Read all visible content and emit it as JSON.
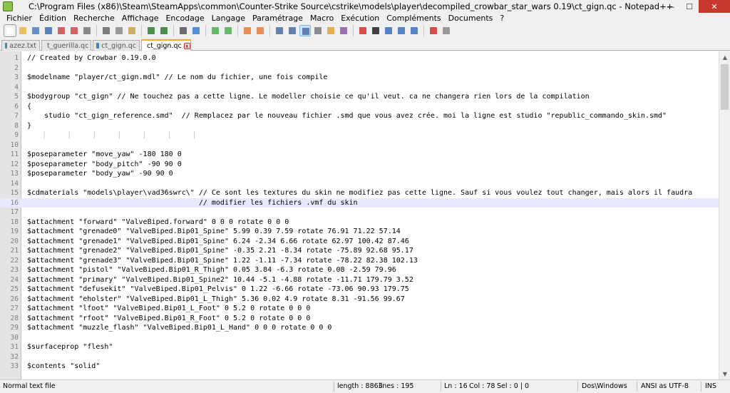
{
  "window": {
    "title": "C:\\Program Files (x86)\\Steam\\SteamApps\\common\\Counter-Strike Source\\cstrike\\models\\player\\decompiled_crowbar_star_wars 0.19\\ct_gign.qc - Notepad++",
    "minimize": "—",
    "maximize": "☐",
    "close": "✕"
  },
  "menu": [
    "Fichier",
    "Édition",
    "Recherche",
    "Affichage",
    "Encodage",
    "Langage",
    "Paramétrage",
    "Macro",
    "Exécution",
    "Compléments",
    "Documents",
    "?"
  ],
  "tabs": [
    {
      "label": "azez.txt",
      "active": false
    },
    {
      "label": "t_guerilla.qc",
      "active": false
    },
    {
      "label": "ct_gign.qc",
      "active": false
    },
    {
      "label": "ct_gign.qc",
      "active": true
    }
  ],
  "editor": {
    "current_line": 16,
    "lines": [
      {
        "n": "1",
        "text": "// Created by Crowbar 0.19.0.0"
      },
      {
        "n": "2",
        "text": ""
      },
      {
        "n": "3",
        "text": "$modelname \"player/ct_gign.mdl\" // Le nom du fichier, une fois compile"
      },
      {
        "n": "4",
        "text": ""
      },
      {
        "n": "5",
        "text": "$bodygroup \"ct_gign\" // Ne touchez pas a cette ligne. Le modeller choisie ce qu'il veut. ca ne changera rien lors de la compilation"
      },
      {
        "n": "6",
        "text": "{"
      },
      {
        "n": "7",
        "text": "    studio \"ct_gign_reference.smd\"  // Remplacez par le nouveau fichier .smd que vous avez crée. moi la ligne est studio \"republic_commando_skin.smd\""
      },
      {
        "n": "8",
        "text": "}"
      },
      {
        "n": "9",
        "text": "   |    |    |    |    |    |    |"
      },
      {
        "n": "10",
        "text": ""
      },
      {
        "n": "11",
        "text": "$poseparameter \"move_yaw\" -180 180 0"
      },
      {
        "n": "12",
        "text": "$poseparameter \"body_pitch\" -90 90 0"
      },
      {
        "n": "13",
        "text": "$poseparameter \"body_yaw\" -90 90 0"
      },
      {
        "n": "14",
        "text": ""
      },
      {
        "n": "15",
        "text": "$cdmaterials \"models\\player\\vad36swrc\\\" // Ce sont les textures du skin ne modifiez pas cette ligne. Sauf si vous voulez tout changer, mais alors il faudra"
      },
      {
        "n": "16",
        "text": "                                        // modifier les fichiers .vmf du skin"
      },
      {
        "n": "17",
        "text": ""
      },
      {
        "n": "18",
        "text": "$attachment \"forward\" \"ValveBiped.forward\" 0 0 0 rotate 0 0 0"
      },
      {
        "n": "19",
        "text": "$attachment \"grenade0\" \"ValveBiped.Bip01_Spine\" 5.99 0.39 7.59 rotate 76.91 71.22 57.14"
      },
      {
        "n": "20",
        "text": "$attachment \"grenade1\" \"ValveBiped.Bip01_Spine\" 6.24 -2.34 6.66 rotate 62.97 100.42 87.46"
      },
      {
        "n": "21",
        "text": "$attachment \"grenade2\" \"ValveBiped.Bip01_Spine\" -0.35 2.21 -8.34 rotate -75.89 92.68 95.17"
      },
      {
        "n": "22",
        "text": "$attachment \"grenade3\" \"ValveBiped.Bip01_Spine\" 1.22 -1.11 -7.34 rotate -78.22 82.38 102.13"
      },
      {
        "n": "23",
        "text": "$attachment \"pistol\" \"ValveBiped.Bip01_R_Thigh\" 0.05 3.84 -6.3 rotate 0.08 -2.59 79.96"
      },
      {
        "n": "24",
        "text": "$attachment \"primary\" \"ValveBiped.Bip01_Spine2\" 10.44 -5.1 -4.88 rotate -11.71 179.79 3.52"
      },
      {
        "n": "25",
        "text": "$attachment \"defusekit\" \"ValveBiped.Bip01_Pelvis\" 0 1.22 -6.66 rotate -73.06 90.93 179.75"
      },
      {
        "n": "26",
        "text": "$attachment \"eholster\" \"ValveBiped.Bip01_L_Thigh\" 5.36 0.02 4.9 rotate 8.31 -91.56 99.67"
      },
      {
        "n": "27",
        "text": "$attachment \"lfoot\" \"ValveBiped.Bip01_L_Foot\" 0 5.2 0 rotate 0 0 0"
      },
      {
        "n": "28",
        "text": "$attachment \"rfoot\" \"ValveBiped.Bip01_R_Foot\" 0 5.2 0 rotate 0 0 0"
      },
      {
        "n": "29",
        "text": "$attachment \"muzzle_flash\" \"ValveBiped.Bip01_L_Hand\" 0 0 0 rotate 0 0 0"
      },
      {
        "n": "30",
        "text": ""
      },
      {
        "n": "31",
        "text": "$surfaceprop \"flesh\""
      },
      {
        "n": "32",
        "text": ""
      },
      {
        "n": "33",
        "text": "$contents \"solid\""
      }
    ]
  },
  "status": {
    "file_type": "Normal text file",
    "length": "length : 8863",
    "lines": "lines : 195",
    "ln": "Ln : 16",
    "col": "Col : 78",
    "sel": "Sel : 0 | 0",
    "eol": "Dos\\Windows",
    "encoding": "ANSI as UTF-8",
    "mode": "INS"
  }
}
